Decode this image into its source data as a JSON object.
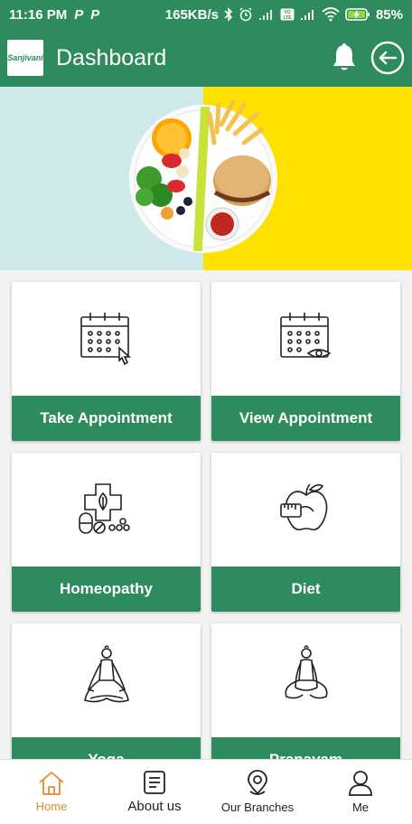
{
  "status_bar": {
    "time": "11:16 PM",
    "notif_1": "P",
    "notif_2": "P",
    "speed": "165KB/s",
    "battery": "85%",
    "icons": [
      "bluetooth-icon",
      "alarm-icon",
      "signal-icon",
      "volte-icon",
      "4g-signal-icon",
      "wifi-icon",
      "battery-charging-icon"
    ]
  },
  "app_bar": {
    "logo_text": "Sanjivani",
    "title": "Dashboard",
    "icons": [
      "bell-icon",
      "logout-icon"
    ]
  },
  "tiles": [
    {
      "label": "Take Appointment",
      "icon": "calendar-click-icon"
    },
    {
      "label": "View Appointment",
      "icon": "calendar-view-icon"
    },
    {
      "label": "Homeopathy",
      "icon": "medical-cross-pills-icon"
    },
    {
      "label": "Diet",
      "icon": "apple-tape-icon"
    },
    {
      "label": "Yoga",
      "icon": "yoga-pose-icon"
    },
    {
      "label": "Pranayam",
      "icon": "pranayam-pose-icon"
    }
  ],
  "bottom_nav": [
    {
      "label": "Home",
      "icon": "home-icon",
      "active": true
    },
    {
      "label": "About us",
      "icon": "document-icon",
      "active": false
    },
    {
      "label": "Our Branches",
      "icon": "location-pin-icon",
      "active": false
    },
    {
      "label": "Me",
      "icon": "user-icon",
      "active": false
    }
  ],
  "colors": {
    "primary": "#2e8b5e",
    "active_nav": "#e58a2a",
    "banner_left": "#cfe8ea",
    "banner_right": "#ffe100"
  }
}
